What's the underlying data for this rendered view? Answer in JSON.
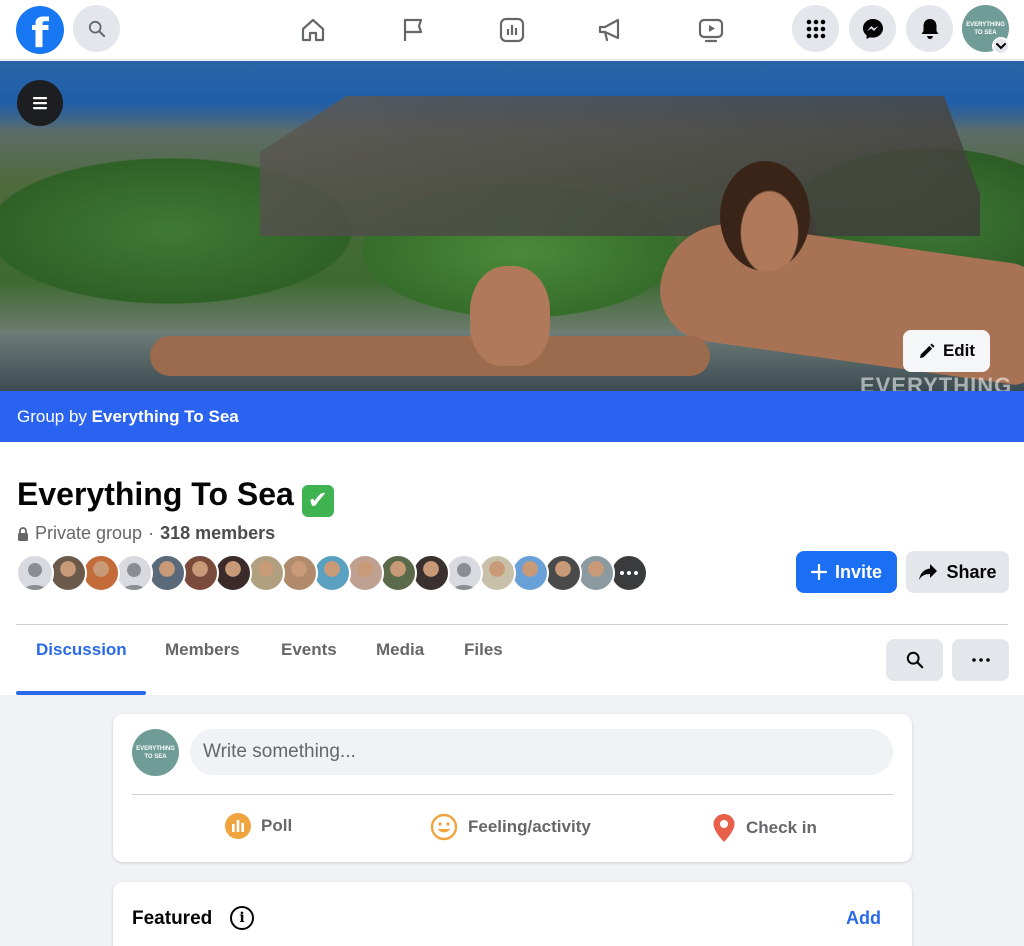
{
  "nav": {
    "logo": "f",
    "icons": [
      "search-icon",
      "home-icon",
      "flag-icon",
      "insights-icon",
      "megaphone-icon",
      "watch-icon",
      "menu-grid-icon",
      "messenger-icon",
      "notifications-icon"
    ],
    "profile_avatar_text": "EVERYTHING TO SEA"
  },
  "cover": {
    "watermark": "EVERYTHING",
    "edit_label": "Edit"
  },
  "group_by": {
    "prefix": "Group by",
    "name": "Everything To Sea"
  },
  "group": {
    "title": "Everything To Sea",
    "privacy": "Private group",
    "separator": "·",
    "members": "318 members"
  },
  "member_avatars": [
    "#9a9a9a",
    "#6b5a4a",
    "#c46b3a",
    "#9a9a9a",
    "#5a6a7a",
    "#7a4a3a",
    "#3a2a2a",
    "#b0a080",
    "#b08a6a",
    "#5aa0c0",
    "#c0a090",
    "#5a6a4a",
    "#3a3030",
    "#9a9a9a",
    "#c8c0a8",
    "#6aa0d8",
    "#4a4a4a",
    "#8a9aa0",
    "#2a2a2a"
  ],
  "actions": {
    "invite": "Invite",
    "share": "Share"
  },
  "tabs": [
    {
      "label": "Discussion",
      "active": true
    },
    {
      "label": "Members",
      "active": false
    },
    {
      "label": "Events",
      "active": false
    },
    {
      "label": "Media",
      "active": false
    },
    {
      "label": "Files",
      "active": false
    }
  ],
  "composer": {
    "avatar_text": "EVERYTHING TO SEA",
    "placeholder": "Write something...",
    "poll": "Poll",
    "feeling": "Feeling/activity",
    "checkin": "Check in"
  },
  "featured": {
    "title": "Featured",
    "add": "Add"
  },
  "colors": {
    "primary": "#1b6ff3",
    "banner": "#2a63f0",
    "verified": "#3eb34f"
  }
}
